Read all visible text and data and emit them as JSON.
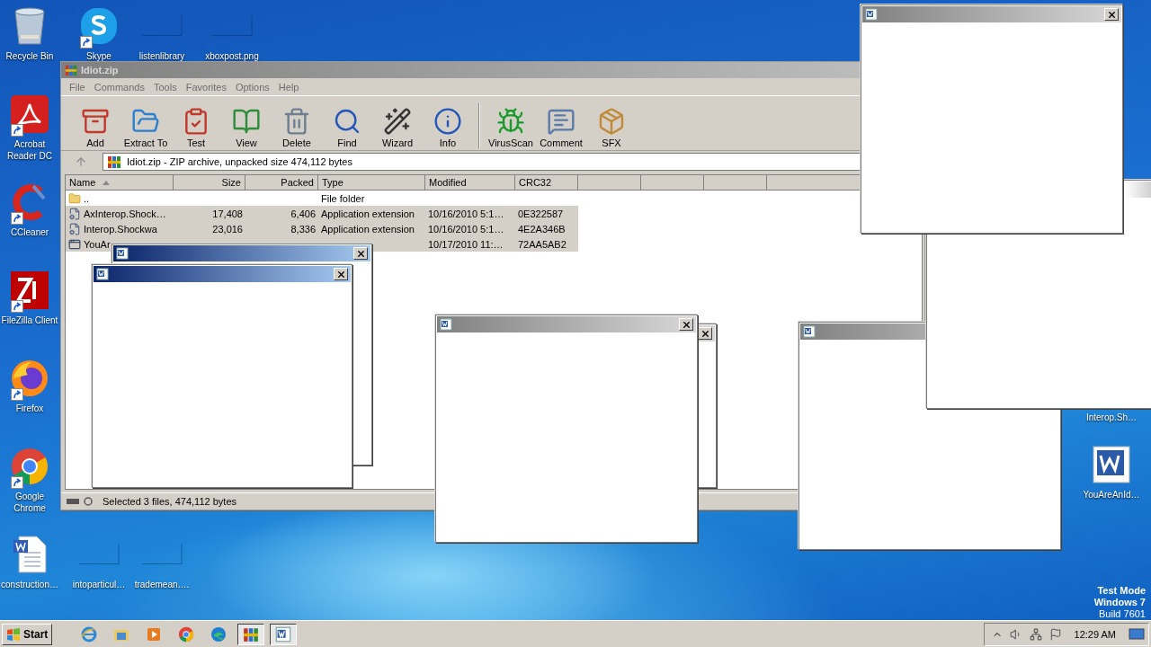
{
  "desktop_icons": [
    {
      "label": "Recycle Bin",
      "kind": "recycle",
      "shortcut": false
    },
    {
      "label": "Skype",
      "kind": "skype",
      "shortcut": true
    },
    {
      "label": "listenlibrary",
      "kind": "blank",
      "shortcut": false
    },
    {
      "label": "xboxpost.png",
      "kind": "blank",
      "shortcut": false
    },
    {
      "label": "Acrobat Reader DC",
      "kind": "acrobat",
      "shortcut": true
    },
    {
      "label": "CCleaner",
      "kind": "ccleaner",
      "shortcut": true
    },
    {
      "label": "FileZilla Client",
      "kind": "filezilla",
      "shortcut": true
    },
    {
      "label": "Firefox",
      "kind": "firefox",
      "shortcut": true
    },
    {
      "label": "Google Chrome",
      "kind": "chrome",
      "shortcut": true
    },
    {
      "label": "construction…",
      "kind": "worddoc",
      "shortcut": false
    },
    {
      "label": "intoparticul…",
      "kind": "blank",
      "shortcut": false
    },
    {
      "label": "trademean….",
      "kind": "blank",
      "shortcut": false
    },
    {
      "label": "Interop.Sh…"
    },
    {
      "label": "YouAreAnId…",
      "kind": "word",
      "shortcut": false
    }
  ],
  "archive_window": {
    "title": "Idiot.zip",
    "menu": [
      "File",
      "Commands",
      "Tools",
      "Favorites",
      "Options",
      "Help"
    ],
    "toolbar": [
      {
        "label": "Add",
        "kind": "add"
      },
      {
        "label": "Extract To",
        "kind": "extract"
      },
      {
        "label": "Test",
        "kind": "test"
      },
      {
        "label": "View",
        "kind": "view"
      },
      {
        "label": "Delete",
        "kind": "delete"
      },
      {
        "label": "Find",
        "kind": "find"
      },
      {
        "label": "Wizard",
        "kind": "wizard"
      },
      {
        "label": "Info",
        "kind": "info"
      },
      {
        "label": "VirusScan",
        "kind": "virus"
      },
      {
        "label": "Comment",
        "kind": "comment"
      },
      {
        "label": "SFX",
        "kind": "sfx"
      }
    ],
    "address": "Idiot.zip - ZIP archive, unpacked size 474,112 bytes",
    "columns": [
      {
        "label": "Name",
        "sorted": true
      },
      {
        "label": "Size",
        "sorted": false
      },
      {
        "label": "Packed",
        "sorted": false
      },
      {
        "label": "Type",
        "sorted": false
      },
      {
        "label": "Modified",
        "sorted": false
      },
      {
        "label": "CRC32",
        "sorted": false
      }
    ],
    "rows": [
      {
        "kind": "folder",
        "selected": false,
        "name": "..",
        "type": "File folder"
      },
      {
        "kind": "dll",
        "selected": true,
        "name": "AxInterop.Shock…",
        "size": "17,408",
        "packed": "6,406",
        "type": "Application extension",
        "modified": "10/16/2010 5:1…",
        "crc": "0E322587"
      },
      {
        "kind": "dll",
        "selected": true,
        "name": "Interop.Shockwa",
        "size": "23,016",
        "packed": "8,336",
        "type": "Application extension",
        "modified": "10/16/2010 5:1…",
        "crc": "4E2A346B"
      },
      {
        "kind": "exe",
        "selected": true,
        "name": "YouAr",
        "modified": "10/17/2010 11:…",
        "crc": "72AA5AB2"
      }
    ],
    "status": "Selected 3 files, 474,112 bytes"
  },
  "popups": [
    {
      "kind": "blue"
    },
    {
      "kind": "blue"
    },
    {
      "kind": "gray"
    },
    {
      "kind": "gray"
    },
    {
      "kind": "gray"
    },
    {
      "kind": "plain"
    },
    {
      "kind": "gray"
    }
  ],
  "system_notice": [
    "Test Mode",
    "Windows 7",
    "Build 7601"
  ],
  "taskbar": {
    "start": "Start",
    "apps": [
      {
        "kind": "ie"
      },
      {
        "kind": "explorer"
      },
      {
        "kind": "media"
      },
      {
        "kind": "chrome"
      },
      {
        "kind": "edge"
      },
      {
        "kind": "winrar"
      },
      {
        "kind": "word"
      }
    ],
    "time": "12:29 AM"
  }
}
